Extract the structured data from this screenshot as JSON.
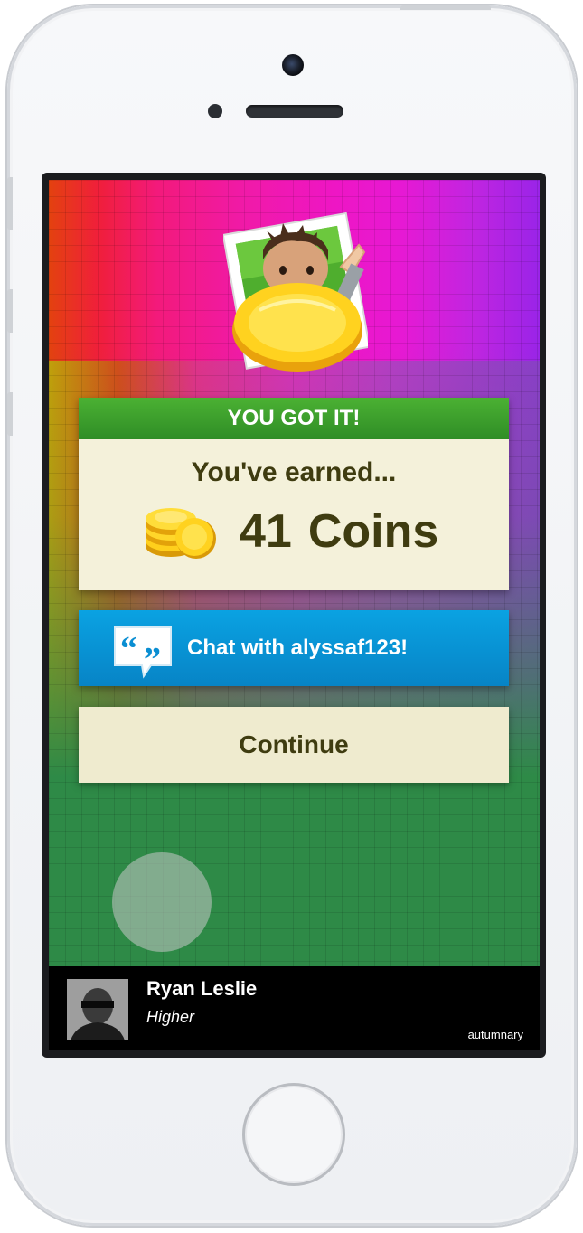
{
  "device": {
    "frame_color": "#f4f5f7",
    "screen_bezel_color": "#1b1c1f"
  },
  "game": {
    "header": "YOU GOT IT!",
    "earned_label": "You've earned...",
    "coins_amount": "41",
    "coins_unit": "Coins",
    "chat_button_label": "Chat with alyssaf123!",
    "continue_button_label": "Continue",
    "colors": {
      "header_green": "#3aa02d",
      "panel_bg": "#f4f1da",
      "chat_blue": "#0a94d6",
      "text_olive": "#3f3c10",
      "board_green": "#2e8a47"
    },
    "icons": {
      "avatar": "avatar-coin-emblem-icon",
      "coins": "coin-stack-icon",
      "chat": "quote-speech-bubble-icon"
    }
  },
  "now_playing": {
    "artist": "Ryan Leslie",
    "track": "Higher",
    "watermark": "autumnary"
  }
}
